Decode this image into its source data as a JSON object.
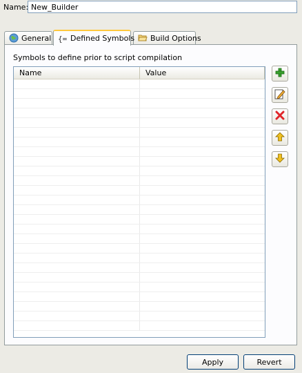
{
  "name_field": {
    "label": "Name:",
    "value": "New_Builder"
  },
  "tabs": [
    {
      "label": "General",
      "icon": "globe-icon",
      "active": false
    },
    {
      "label": "Defined Symbols",
      "icon": "braces-icon",
      "active": true
    },
    {
      "label": "Build Options",
      "icon": "folder-icon",
      "active": false
    }
  ],
  "symbols_section": {
    "label": "Symbols to define prior to script compilation",
    "columns": [
      "Name",
      "Value"
    ],
    "rows": []
  },
  "side_buttons": [
    {
      "name": "add-symbol-button",
      "icon": "plus-icon"
    },
    {
      "name": "edit-symbol-button",
      "icon": "pencil-icon"
    },
    {
      "name": "remove-symbol-button",
      "icon": "red-x-icon"
    },
    {
      "name": "move-up-button",
      "icon": "arrow-up-icon"
    },
    {
      "name": "move-down-button",
      "icon": "arrow-down-icon"
    }
  ],
  "buttons": {
    "apply": "Apply",
    "revert": "Revert"
  },
  "colors": {
    "active_tab_accent": "#ffc83c",
    "add_icon": "#3aa02e",
    "remove_icon": "#e0262a",
    "arrow_icon": "#f0c020"
  }
}
